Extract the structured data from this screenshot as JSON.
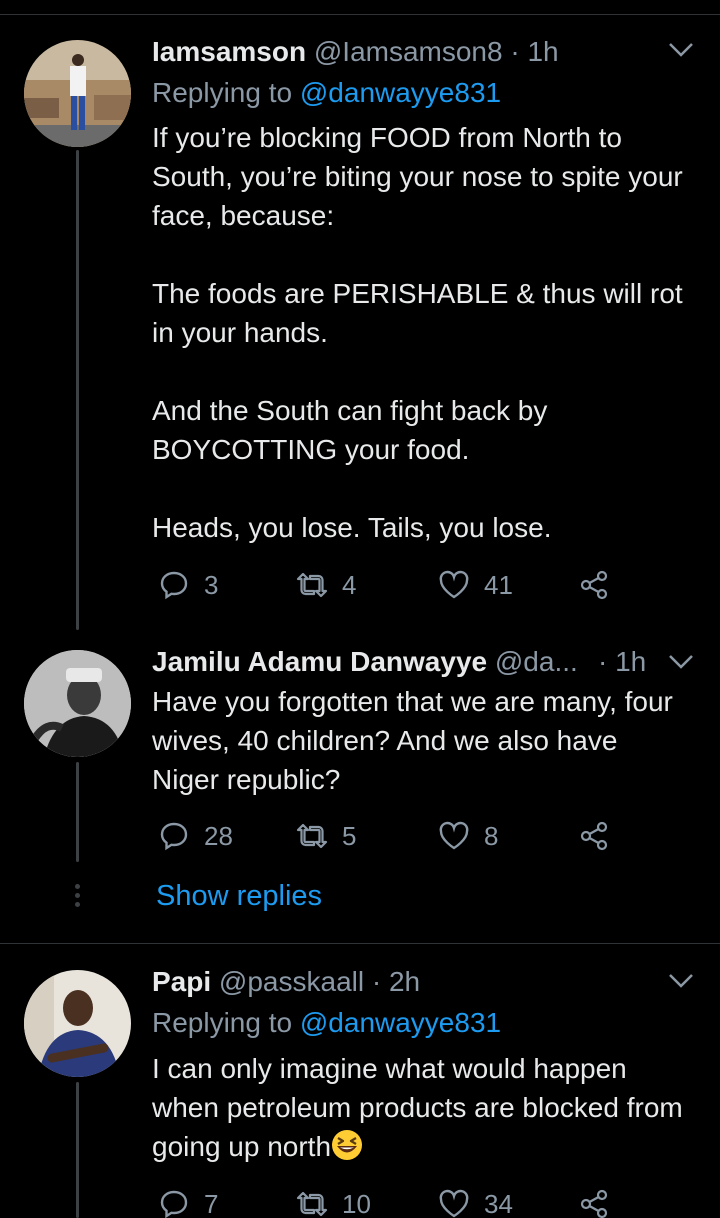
{
  "tweets": [
    {
      "display_name": "Iamsamson",
      "handle": "@Iamsamson8",
      "time": " · 1h",
      "replying_label": "Replying to ",
      "replying_to": "@danwayye831",
      "text": "If you’re blocking FOOD from North to South, you’re biting your nose to spite your face, because:\n\nThe foods are PERISHABLE & thus will rot in your hands.\n\nAnd the South can fight back by BOYCOTTING your food.\n\nHeads, you lose. Tails, you lose.",
      "replies": "3",
      "retweets": "4",
      "likes": "41"
    },
    {
      "display_name": "Jamilu Adamu Danwayye",
      "handle": "@da...",
      "time": "· 1h",
      "text": "Have you forgotten that we are many, four wives, 40 children? And we also have Niger republic?",
      "replies": "28",
      "retweets": "5",
      "likes": "8"
    },
    {
      "display_name": "Papi",
      "handle": "@passkaall",
      "time": " · 2h",
      "replying_label": "Replying to ",
      "replying_to": "@danwayye831",
      "text": "I can only imagine what would happen when petroleum products are blocked from going up north",
      "emoji": "laughing-squinting-face",
      "replies": "7",
      "retweets": "10",
      "likes": "34"
    }
  ],
  "show_replies_label": "Show replies",
  "colors": {
    "background": "#000000",
    "text": "#e7e9ea",
    "muted": "#8b98a5",
    "accent": "#1d9bf0",
    "divider": "#2f3336"
  }
}
